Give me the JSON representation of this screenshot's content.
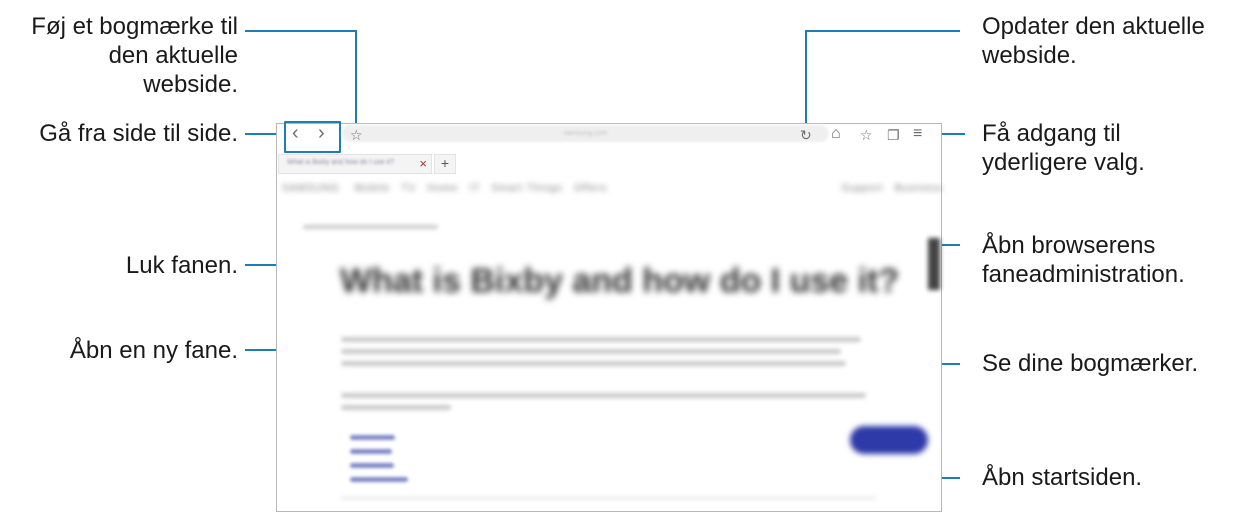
{
  "callouts": {
    "bookmark": {
      "lines": [
        "Føj et bogmærke til",
        "den aktuelle",
        "webside."
      ]
    },
    "navigate": {
      "lines": [
        "Gå fra side til side."
      ]
    },
    "close_tab": {
      "lines": [
        "Luk fanen."
      ]
    },
    "new_tab": {
      "lines": [
        "Åbn en ny fane."
      ]
    },
    "refresh": {
      "lines": [
        "Opdater den aktuelle",
        "webside."
      ]
    },
    "more_options": {
      "lines": [
        "Få adgang til",
        "yderligere valg."
      ]
    },
    "tab_manager": {
      "lines": [
        "Åbn browserens",
        "faneadministration."
      ]
    },
    "bookmarks": {
      "lines": [
        "Se dine bogmærker."
      ]
    },
    "home": {
      "lines": [
        "Åbn startsiden."
      ]
    }
  },
  "browser": {
    "back_glyph": "‹",
    "forward_glyph": "›",
    "bookmark_glyph": "☆",
    "refresh_glyph": "↻",
    "home_glyph": "⌂",
    "bookmarks_glyph": "☆",
    "tabs_glyph": "❐",
    "menu_glyph": "≡",
    "close_glyph": "×",
    "new_tab_glyph": "+",
    "page_heading": "What is Bixby and how do I use it?",
    "callout_line_color": "#1e7db3",
    "button_color": "#2d3aa8"
  }
}
